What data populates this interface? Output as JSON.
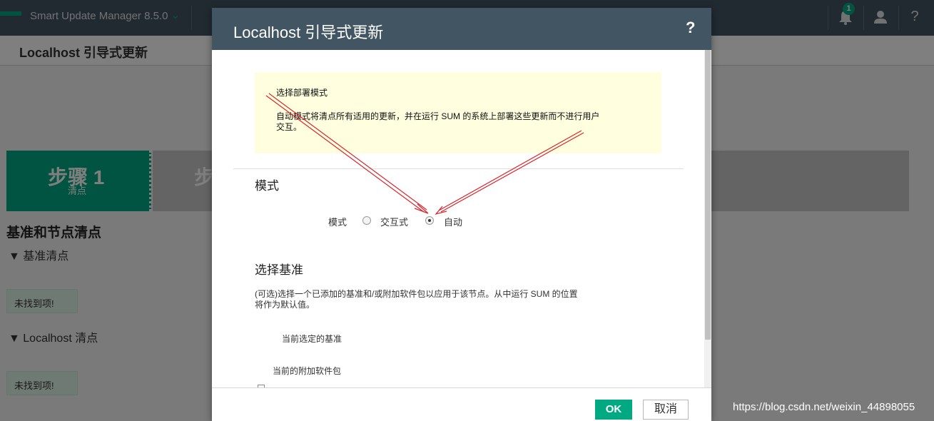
{
  "header": {
    "app_name": "Smart Update Manager 8.5.0",
    "chevron_icon": "chevron-down-icon",
    "notification_count": "1",
    "icons": [
      "bell-icon",
      "user-icon",
      "help-icon"
    ],
    "help_glyph": "?"
  },
  "page": {
    "title": "Localhost 引导式更新"
  },
  "steps": {
    "step1_label": "步骤 1",
    "step1_sub": "清点",
    "step2_label_partial": "步"
  },
  "background": {
    "heading": "基准和节点清点",
    "baseline_section": "▼ 基准清点",
    "localhost_section": "▼ Localhost 清点",
    "not_found_1": "未找到项!",
    "not_found_2": "未找到项!"
  },
  "modal": {
    "title": "Localhost 引导式更新",
    "help_label": "?",
    "info": {
      "title": "选择部署模式",
      "text": "自动模式将清点所有适用的更新，并在运行 SUM 的系统上部署这些更新而不进行用户交互。"
    },
    "mode_section": {
      "heading": "模式",
      "label": "模式",
      "options": [
        {
          "label": "交互式",
          "checked": false
        },
        {
          "label": "自动",
          "checked": true
        }
      ]
    },
    "baseline_section": {
      "heading": "选择基准",
      "description": "(可选)选择一个已添加的基准和/或附加软件包以应用于该节点。从中运行 SUM 的位置将作为默认值。",
      "current_baseline_label": "当前选定的基准",
      "current_addon_label": "当前的附加软件包"
    },
    "footer": {
      "ok_label": "OK",
      "cancel_label": "取消"
    }
  },
  "annotation_color": "#d9262c",
  "accent_color": "#01a982",
  "watermark": "https://blog.csdn.net/weixin_44898055"
}
